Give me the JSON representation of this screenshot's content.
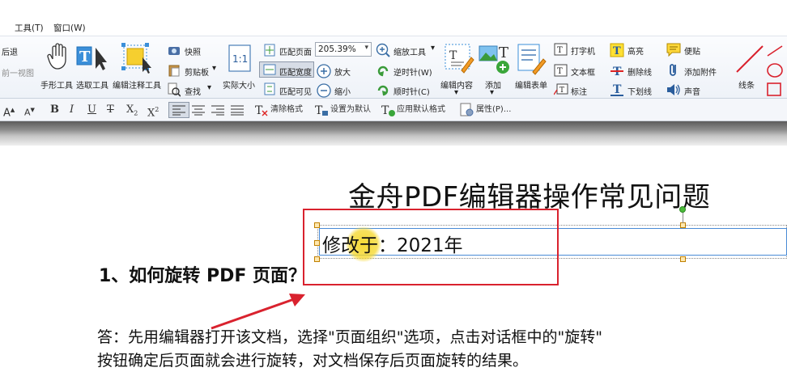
{
  "menubar": {
    "tools": "工具(T)",
    "window": "窗口(W)"
  },
  "ribbon": {
    "back": "后退",
    "prev_view": "前一视图",
    "hand_tool": "手形工具",
    "select_tool": "选取工具",
    "annotation_tool": "编辑注释工具",
    "snapshot": "快照",
    "clipboard": "剪贴板",
    "find": "查找",
    "actual_size": "实际大小",
    "fit_page": "匹配页面",
    "fit_width": "匹配宽度",
    "fit_visible": "匹配可见",
    "zoom_value": "205.39%",
    "zoom_tool": "缩放工具",
    "zoom_in": "放大",
    "zoom_out": "缩小",
    "rotate_ccw": "逆时针(W)",
    "rotate_cw": "顺时针(C)",
    "edit_content": "编辑内容",
    "add": "添加",
    "edit_form": "编辑表单",
    "typewriter": "打字机",
    "textbox": "文本框",
    "callout": "标注",
    "highlight": "高亮",
    "strikethrough": "删除线",
    "underline": "下划线",
    "note": "便贴",
    "attach": "添加附件",
    "sound": "声音",
    "line": "线条"
  },
  "format": {
    "clear_format": "清除格式",
    "set_default": "设置为默认",
    "apply_default": "应用默认格式",
    "properties": "属性(P)..."
  },
  "document": {
    "title": "金舟PDF编辑器操作常见问题",
    "edit_text": "修改于：2021年",
    "q1": "1、如何旋转 PDF 页面？",
    "answer_line1": "答：先用编辑器打开该文档，选择\"页面组织\"选项，点击对话框中的\"旋转\"",
    "answer_line2": "按钮确定后页面就会进行旋转，对文档保存后页面旋转的结果。"
  },
  "colors": {
    "annotation_red": "#d9222e",
    "cursor_highlight": "#f5d728",
    "selection_blue": "#4a8bd6"
  }
}
